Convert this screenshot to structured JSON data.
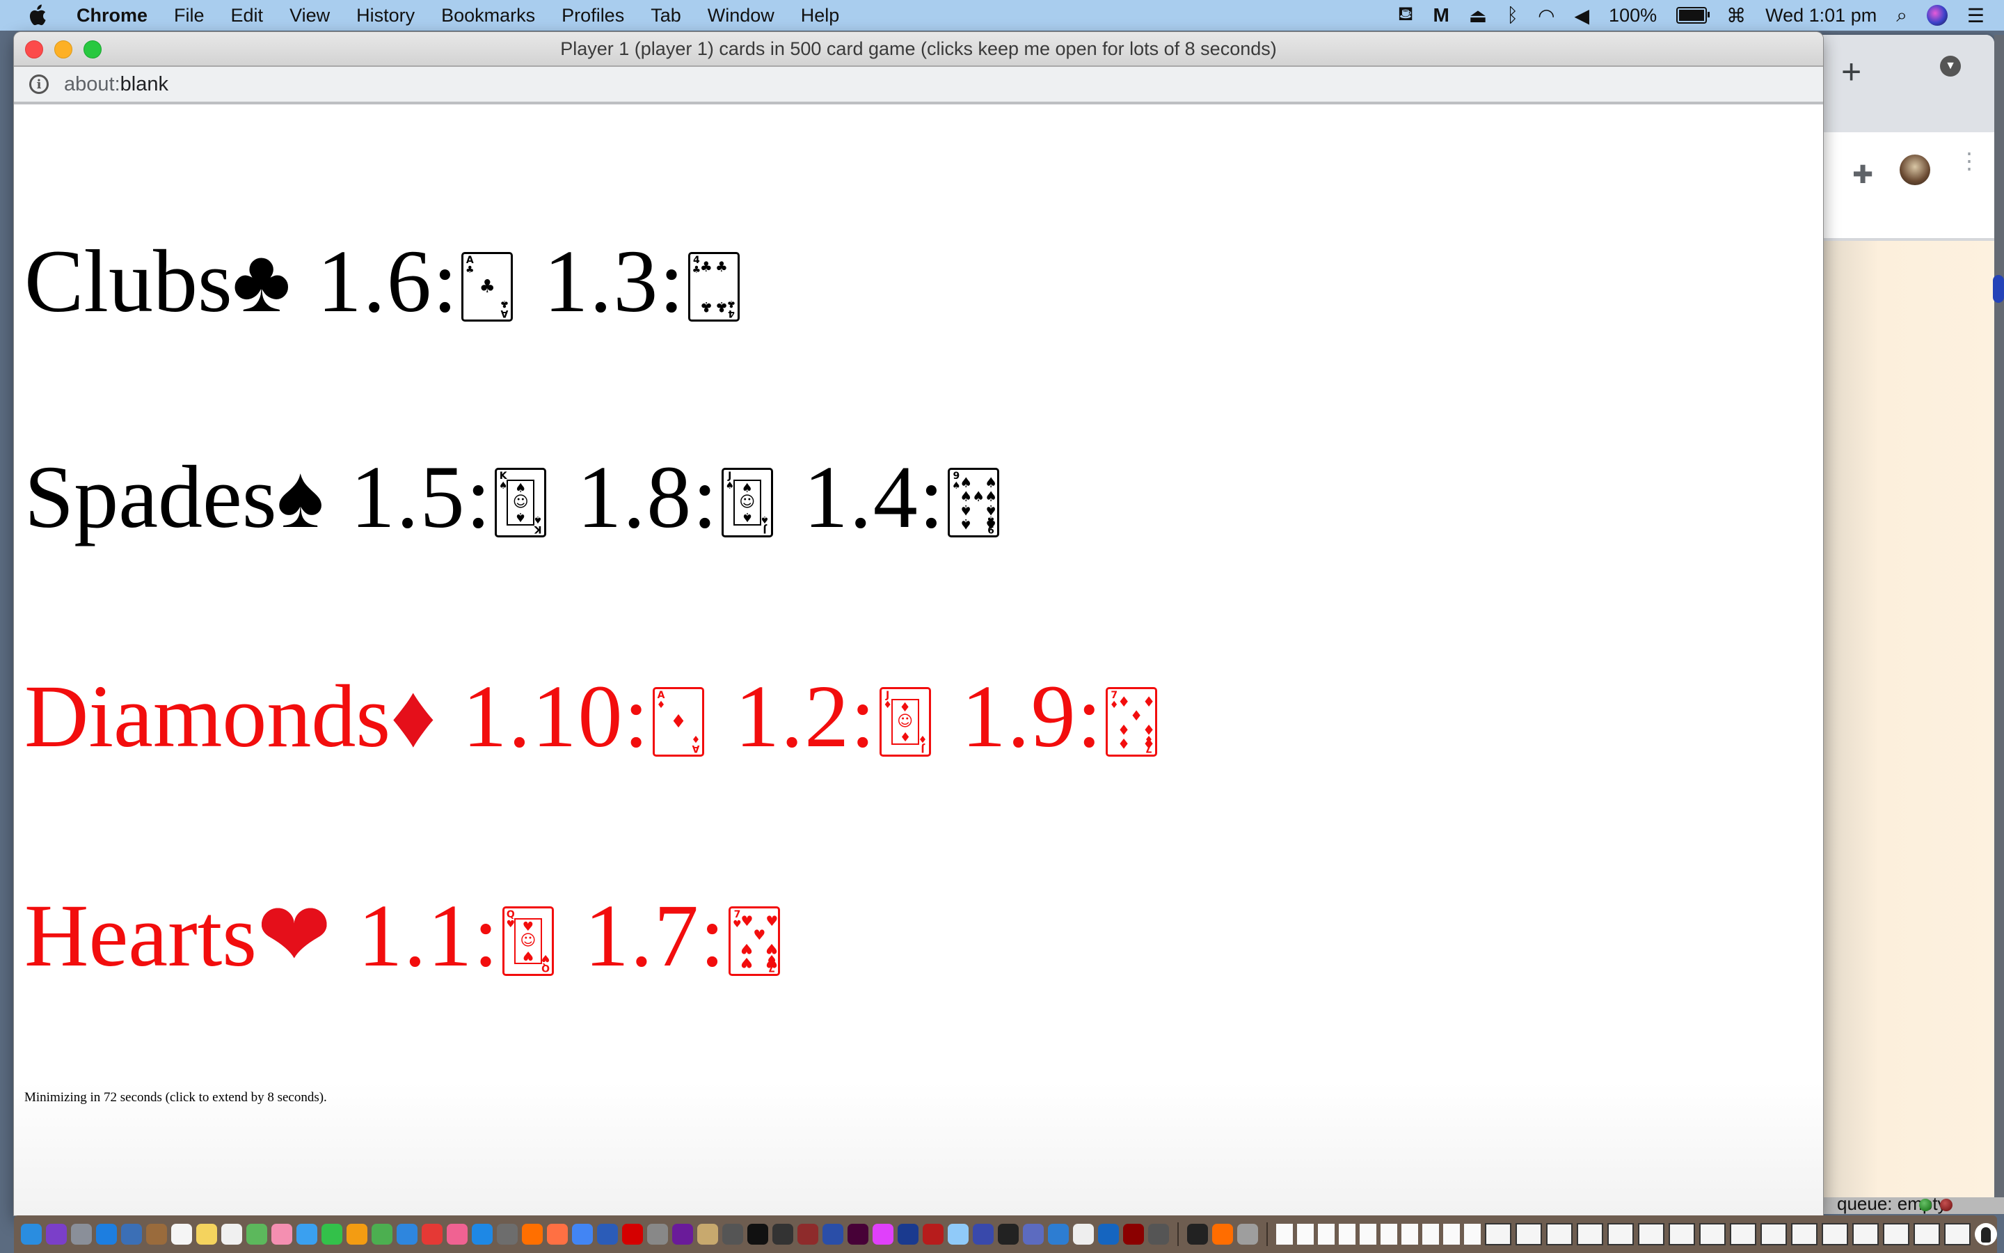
{
  "menubar": {
    "apple_icon": "apple-logo",
    "items": [
      "Chrome",
      "File",
      "Edit",
      "View",
      "History",
      "Bookmarks",
      "Profiles",
      "Tab",
      "Window",
      "Help"
    ],
    "status": {
      "battery_percent": "100%",
      "clock": "Wed 1:01 pm"
    }
  },
  "window": {
    "title": "Player 1 (player 1) cards in 500 card game (clicks keep me open for lots of 8 seconds)",
    "url_scheme": "about:",
    "url_host": "blank"
  },
  "hand": {
    "suits": [
      {
        "name": "Clubs",
        "symbol": "♣",
        "color": "#000000",
        "cards": [
          {
            "label": "1.6:",
            "rank": "A",
            "suit": "♣"
          },
          {
            "label": "1.3:",
            "rank": "4",
            "suit": "♣"
          }
        ]
      },
      {
        "name": "Spades",
        "symbol": "♠",
        "color": "#000000",
        "cards": [
          {
            "label": "1.5:",
            "rank": "K",
            "suit": "♠"
          },
          {
            "label": "1.8:",
            "rank": "J",
            "suit": "♠"
          },
          {
            "label": "1.4:",
            "rank": "9",
            "suit": "♠"
          }
        ]
      },
      {
        "name": "Diamonds",
        "symbol": "♦",
        "color": "#f20d0d",
        "cards": [
          {
            "label": "1.10:",
            "rank": "A",
            "suit": "♦"
          },
          {
            "label": "1.2:",
            "rank": "J",
            "suit": "♦"
          },
          {
            "label": "1.9:",
            "rank": "7",
            "suit": "♦"
          }
        ]
      },
      {
        "name": "Hearts",
        "symbol": "❤",
        "color": "#f20d0d",
        "cards": [
          {
            "label": "1.1:",
            "rank": "Q",
            "suit": "♥"
          },
          {
            "label": "1.7:",
            "rank": "7",
            "suit": "♥"
          }
        ]
      }
    ]
  },
  "footer": {
    "note": "Minimizing in 72 seconds (click to extend by 8 seconds)."
  },
  "background_window": {
    "statusbar_text": "queue: empty"
  }
}
